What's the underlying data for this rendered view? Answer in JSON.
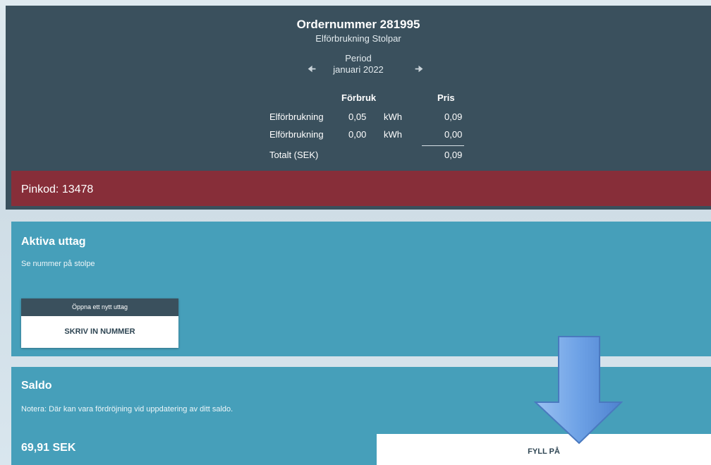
{
  "order": {
    "title": "Ordernummer 281995",
    "subtitle": "Elförbrukning Stolpar",
    "period_label": "Period",
    "period_value": "januari 2022",
    "prev_icon": "arrow-left-icon",
    "next_icon": "arrow-right-icon",
    "table": {
      "headers": {
        "usage": "Förbruk",
        "price": "Pris"
      },
      "rows": [
        {
          "label": "Elförbrukning",
          "value": "0,05",
          "unit": "kWh",
          "price": "0,09"
        },
        {
          "label": "Elförbrukning",
          "value": "0,00",
          "unit": "kWh",
          "price": "0,00"
        }
      ],
      "total_label": "Totalt (SEK)",
      "total_price": "0,09"
    }
  },
  "pin": {
    "text": "Pinkod: 13478",
    "color": "#872e39"
  },
  "aktiva": {
    "title": "Aktiva uttag",
    "description": "Se nummer på stolpe",
    "card_header": "Öppna ett nytt uttag",
    "button_label": "SKRIV IN NUMMER"
  },
  "saldo": {
    "title": "Saldo",
    "note": "Notera: Där kan vara fördröjning vid uppdatering av ditt saldo.",
    "amount": "69,91 SEK",
    "button_label": "FYLL PÅ"
  },
  "colors": {
    "header_bg": "#3a505d",
    "panel_bg": "#469fba",
    "arrow_fill": "#6a9de0"
  }
}
